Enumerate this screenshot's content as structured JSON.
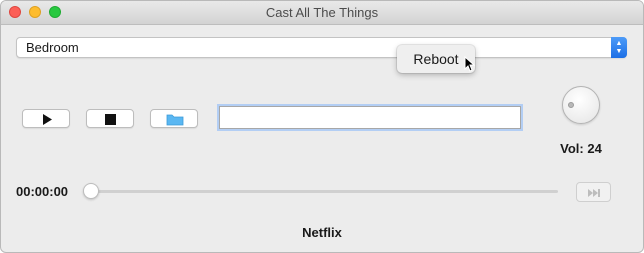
{
  "window": {
    "title": "Cast All The Things"
  },
  "device": {
    "selected": "Bedroom"
  },
  "context_menu": {
    "items": [
      {
        "label": "Reboot"
      }
    ]
  },
  "controls": {
    "play_icon": "play-icon",
    "stop_icon": "stop-icon",
    "folder_icon": "folder-icon"
  },
  "url_input": {
    "value": "",
    "placeholder": ""
  },
  "volume": {
    "label": "Vol: 24",
    "value": 24
  },
  "seek": {
    "time": "00:00:00",
    "progress": 0
  },
  "status": {
    "text": "Netflix"
  },
  "colors": {
    "accent": "#1c6fe6",
    "folder": "#5ab7f2",
    "focus_ring": "#b3cef4"
  }
}
